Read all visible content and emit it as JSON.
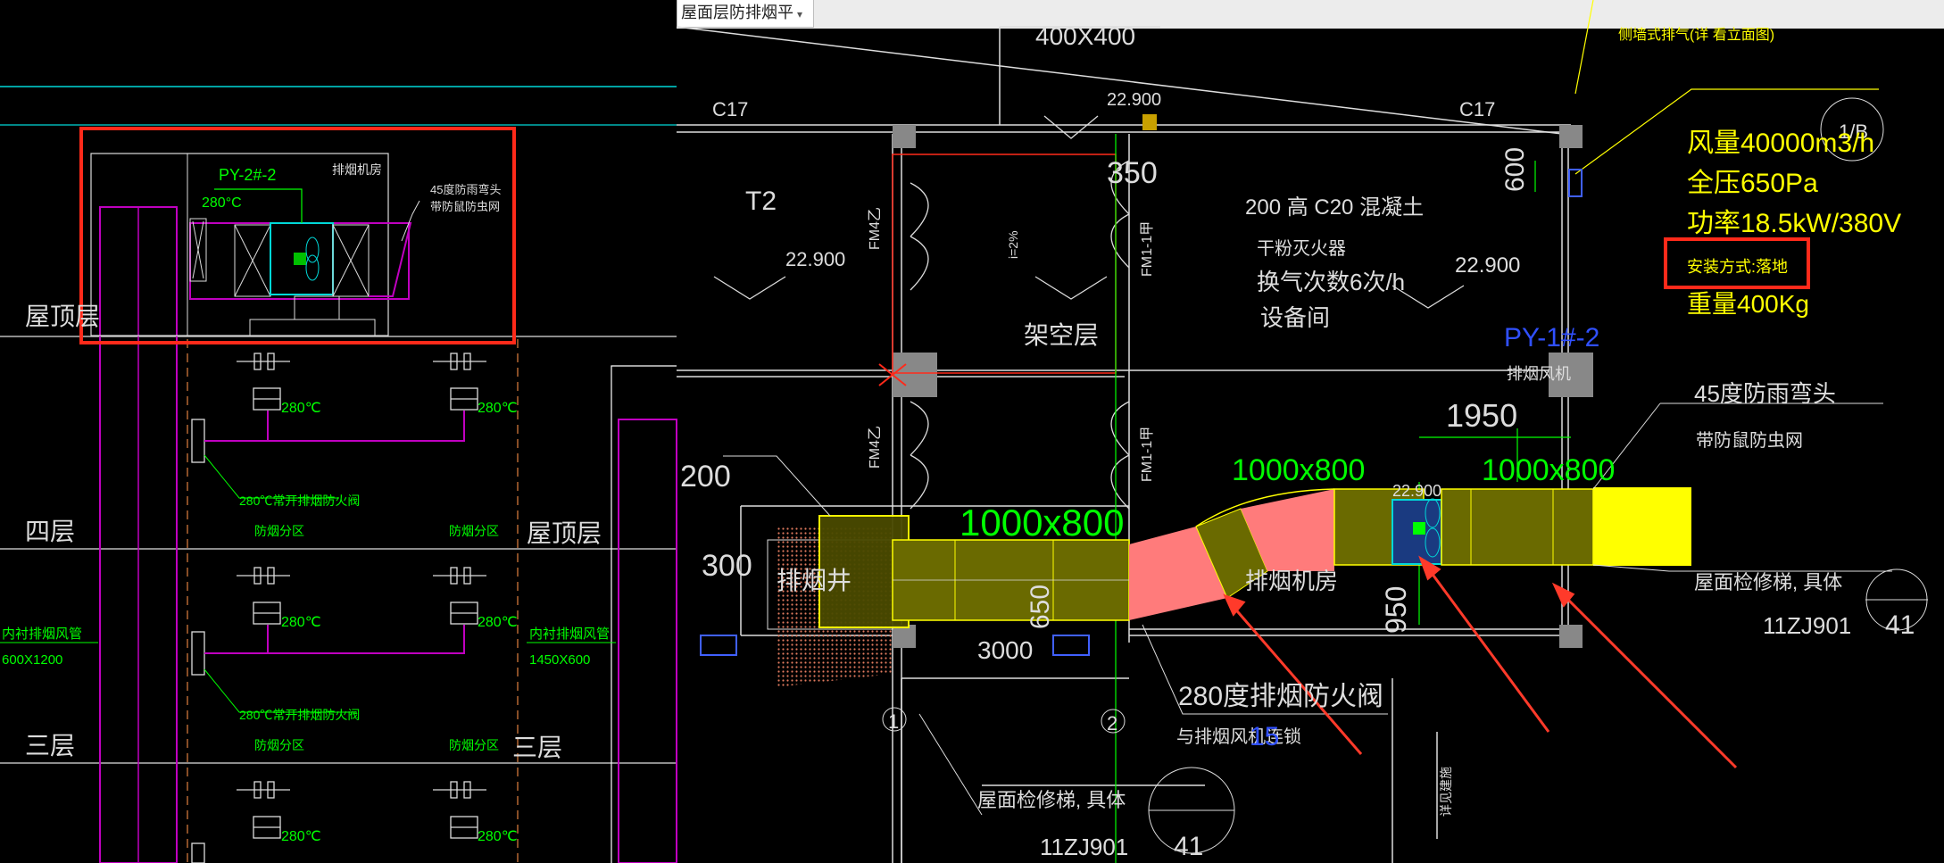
{
  "tab": {
    "label": "屋面层防排烟平",
    "arrow": "▾"
  },
  "colors": {
    "background": "#000000",
    "red": "#ff2a1a",
    "yellow": "#ffff00",
    "green": "#00ff00",
    "magenta": "#c000c0",
    "cyan": "#00d8d8"
  },
  "left": {
    "floors": {
      "roof": "屋顶层",
      "f4": "四层",
      "f3": "三层",
      "roof_right": "屋顶层",
      "f3_right": "三层"
    },
    "fan_id": "PY-2#-2",
    "fan_room": "排烟机房",
    "temp_top": "280°C",
    "bend_line1": "45度防雨弯头",
    "bend_line2": "带防鼠防虫网",
    "temp": "280℃",
    "valve_note": "280℃常开排烟防火阀",
    "zone": "防烟分区",
    "duct_label": "内衬排烟风管",
    "duct_size_left": "600X1200",
    "duct_size_right": "1450X600"
  },
  "right": {
    "top_dim": "400X400",
    "elev_top": "22.900",
    "c17a": "C17",
    "c17b": "C17",
    "note_top": "侧墙式排气(详 看立面图)",
    "axis_1b": "1/B",
    "specs": [
      "风量40000m3/h",
      "全压650Pa",
      "功率18.5kW/380V",
      "安装方式:落地",
      "重量400Kg"
    ],
    "t2": "T2",
    "elev_left": "22.900",
    "fm4a": "FM4乙",
    "fm4b": "FM4乙",
    "fm1a": "FM1-1甲",
    "fm1b": "FM1-1甲",
    "slope": "i=2%",
    "dim350": "350",
    "dim600": "600",
    "slab_note": "200 高 C20 混凝土",
    "extinguisher": "干粉灭火器",
    "air_change": "换气次数6次/h",
    "equipment_room": "设备间",
    "elev_right": "22.900",
    "overhead": "架空层",
    "fan_id": "PY-1#-2",
    "fan_label": "排烟风机",
    "bend_label": "45度防雨弯头",
    "mesh_label": "带防鼠防虫网",
    "dim1950": "1950",
    "duct_a": "1000x800",
    "duct_b": "1000x800",
    "duct_c": "1000x800",
    "elev_duct": "22.900",
    "dim200": "200",
    "dim300": "300",
    "shaft": "排烟井",
    "dim650": "650",
    "dim3000": "3000",
    "fan_room": "排烟机房",
    "dim950": "950",
    "roof_ladder": "屋面检修梯, 具体",
    "ref_11zj": "11ZJ901",
    "ref_41": "41",
    "axis1": "1",
    "axis2": "2",
    "valve280": "280度排烟防火阀",
    "valve_link": "与排烟风机连锁",
    "code15": "15",
    "roof_ladder2": "屋面检修梯, 具体",
    "ref2_11zj": "11ZJ901",
    "ref2_41": "41",
    "vert_note": "详见建施"
  }
}
